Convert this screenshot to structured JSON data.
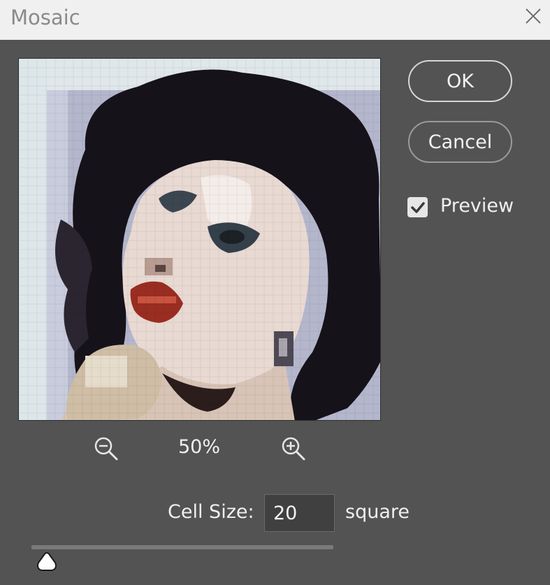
{
  "window": {
    "title": "Mosaic"
  },
  "preview": {
    "zoom": "50%"
  },
  "buttons": {
    "ok": "OK",
    "cancel": "Cancel"
  },
  "preview_toggle": {
    "label": "Preview",
    "checked": true
  },
  "cell_size": {
    "label": "Cell Size:",
    "value": "20",
    "unit": "square",
    "slider_fraction": 0.05
  }
}
